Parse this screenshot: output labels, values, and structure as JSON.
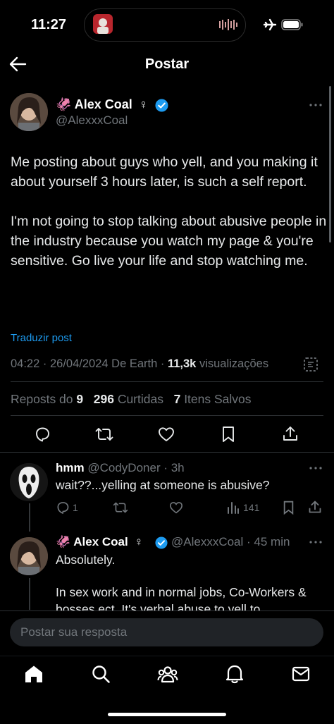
{
  "status_bar": {
    "time": "11:27"
  },
  "header": {
    "title": "Postar"
  },
  "post": {
    "display_name": "Alex Coal",
    "name_emoji": "🦑",
    "gender_symbol": "♀",
    "handle": "@AlexxxCoal",
    "paragraph_1": "Me posting about guys who yell, and you making it about yourself 3 hours later, is such a self report.",
    "paragraph_2": "I'm not going to stop talking about abusive people in the industry because you watch my page & you're sensitive. Go live your life and stop watching me.",
    "translate_label": "Traduzir post",
    "time": "04:22",
    "date": "26/04/2024",
    "source": "De Earth",
    "views_count": "11,3k",
    "views_label": "visualizações",
    "reposts_label": "Reposts do",
    "reposts_count": "9",
    "likes_count": "296",
    "likes_label": "Curtidas",
    "saves_count": "7",
    "saves_label": "Itens Salvos"
  },
  "reply_1": {
    "display_name": "hmm",
    "handle": "@CodyDoner",
    "age": "3h",
    "text": "wait??...yelling at someone is abusive?",
    "reply_count": "1",
    "views_count": "141"
  },
  "reply_2": {
    "display_name": "Alex Coal",
    "name_emoji": "🦑",
    "gender_symbol": "♀",
    "handle": "@AlexxxCoal",
    "age": "45 min",
    "line_1": "Absolutely.",
    "line_2": "In sex work and in normal jobs, Co-Workers &",
    "line_3": "bosses ect. It's verbal abuse to yell to"
  },
  "composer": {
    "placeholder": "Postar sua resposta"
  },
  "colors": {
    "accent": "#1d9bf0",
    "verified": "#1d9bf0",
    "background": "#000000",
    "muted": "#71767b"
  }
}
